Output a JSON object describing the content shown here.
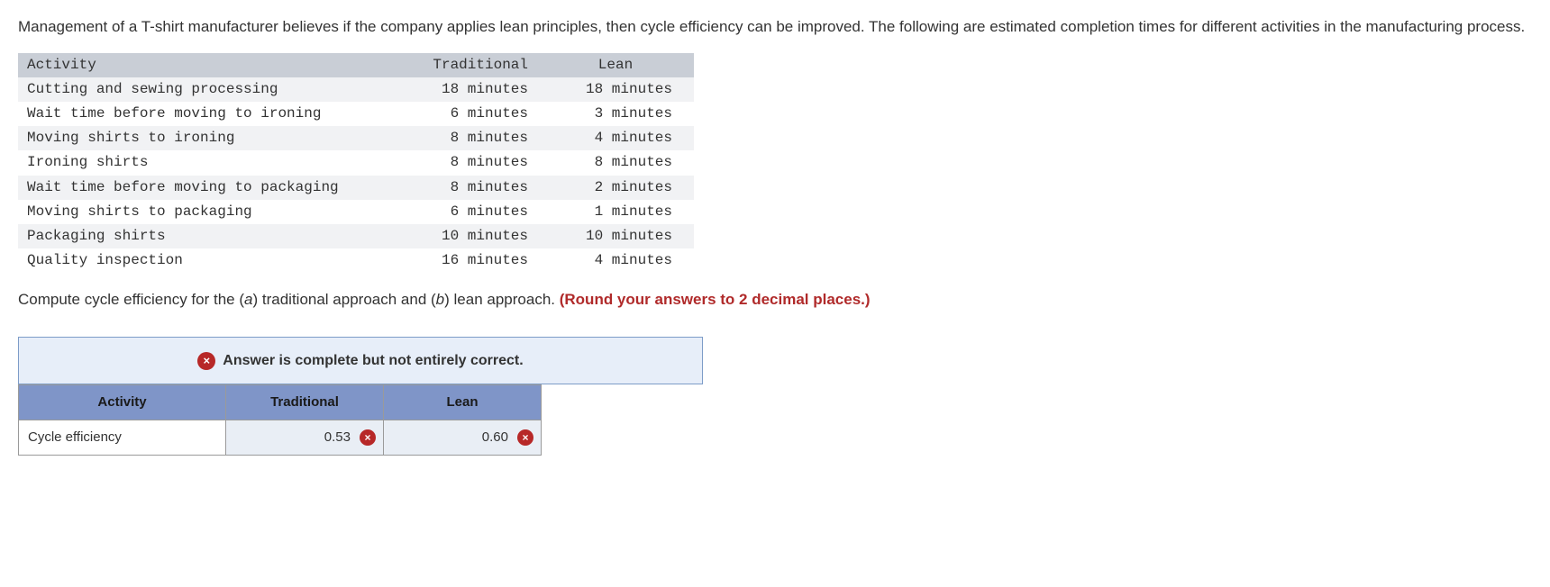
{
  "intro": "Management of a T-shirt manufacturer believes if the company applies lean principles, then cycle efficiency can be improved. The following are estimated completion times for different activities in the manufacturing process.",
  "table": {
    "headers": {
      "activity": "Activity",
      "traditional": "Traditional",
      "lean": "Lean"
    },
    "rows": [
      {
        "activity": "Cutting and sewing processing",
        "traditional": "18 minutes",
        "lean": "18 minutes"
      },
      {
        "activity": "Wait time before moving to ironing",
        "traditional": "6 minutes",
        "lean": "3 minutes"
      },
      {
        "activity": "Moving shirts to ironing",
        "traditional": "8 minutes",
        "lean": "4 minutes"
      },
      {
        "activity": "Ironing shirts",
        "traditional": "8 minutes",
        "lean": "8 minutes"
      },
      {
        "activity": "Wait time before moving to packaging",
        "traditional": "8 minutes",
        "lean": "2 minutes"
      },
      {
        "activity": "Moving shirts to packaging",
        "traditional": "6 minutes",
        "lean": "1 minutes"
      },
      {
        "activity": "Packaging shirts",
        "traditional": "10 minutes",
        "lean": "10 minutes"
      },
      {
        "activity": "Quality inspection",
        "traditional": "16 minutes",
        "lean": "4 minutes"
      }
    ]
  },
  "prompt": {
    "pre": "Compute cycle efficiency for the (",
    "a": "a",
    "mid1": ") traditional approach and (",
    "b": "b",
    "mid2": ") lean approach. ",
    "bold": "(Round your answers to 2 decimal places.)"
  },
  "feedback": {
    "icon": "×",
    "message": "Answer is complete but not entirely correct."
  },
  "answer": {
    "headers": {
      "activity": "Activity",
      "traditional": "Traditional",
      "lean": "Lean"
    },
    "row_label": "Cycle efficiency",
    "traditional": {
      "value": "0.53",
      "mark": "incorrect"
    },
    "lean": {
      "value": "0.60",
      "mark": "incorrect"
    },
    "mark_icon": "×"
  }
}
